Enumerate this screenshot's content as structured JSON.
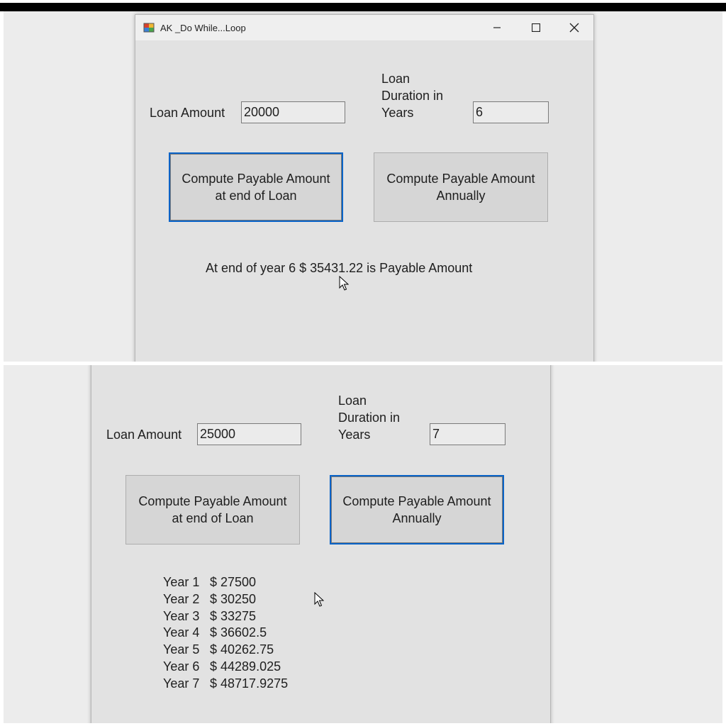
{
  "top": {
    "window": {
      "title": "AK _Do While...Loop",
      "icon": "winforms-app-icon",
      "controls": [
        "minimize-icon",
        "maximize-icon",
        "close-icon"
      ]
    },
    "loan_amount_label": "Loan Amount",
    "loan_amount_value": "20000",
    "duration_label": [
      "Loan",
      "Duration in",
      "Years"
    ],
    "duration_value": "6",
    "button_end": [
      "Compute Payable Amount",
      "at end of Loan"
    ],
    "button_annual": [
      "Compute Payable Amount",
      "Annually"
    ],
    "focused_button": "end",
    "result_text": "At end of year  6  $ 35431.22 is Payable Amount"
  },
  "bottom": {
    "loan_amount_label": "Loan Amount",
    "loan_amount_value": "25000",
    "duration_label": [
      "Loan",
      "Duration in",
      "Years"
    ],
    "duration_value": "7",
    "button_end": [
      "Compute Payable Amount",
      "at end of Loan"
    ],
    "button_annual": [
      "Compute Payable Amount",
      "Annually"
    ],
    "focused_button": "annual",
    "yearly_results": [
      {
        "year": "Year 1",
        "amount": "$ 27500"
      },
      {
        "year": "Year 2",
        "amount": "$ 30250"
      },
      {
        "year": "Year 3",
        "amount": "$ 33275"
      },
      {
        "year": "Year 4",
        "amount": "$ 36602.5"
      },
      {
        "year": "Year 5",
        "amount": "$ 40262.75"
      },
      {
        "year": "Year 6",
        "amount": "$ 44289.025"
      },
      {
        "year": "Year 7",
        "amount": "$ 48717.9275"
      }
    ]
  },
  "colors": {
    "form_background": "#e2e2e2",
    "focus_border": "#0a64c8",
    "outer_background": "#ececec"
  }
}
